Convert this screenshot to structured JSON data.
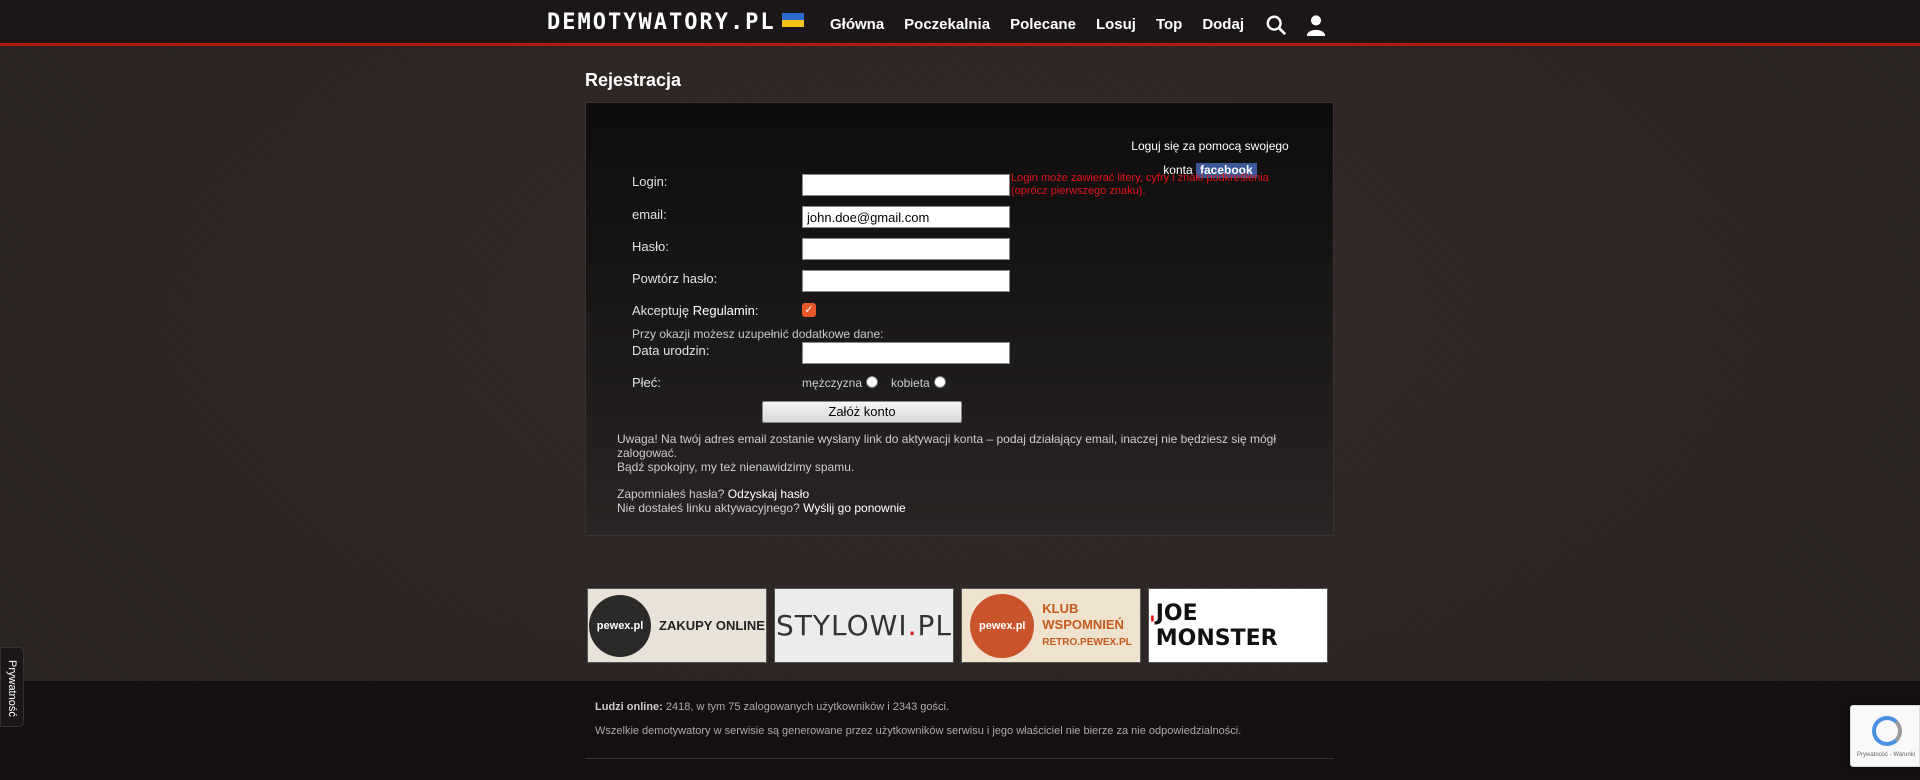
{
  "header": {
    "logo_text": "DEMOTYWATORY.PL",
    "nav": [
      "Główna",
      "Poczekalnia",
      "Polecane",
      "Losuj",
      "Top",
      "Dodaj"
    ],
    "search_icon": "search-icon",
    "user_icon": "user-icon"
  },
  "page": {
    "title": "Rejestracja"
  },
  "facebook": {
    "text_line1": "Loguj się za pomocą swojego",
    "text_line2": "konta",
    "badge": "facebook"
  },
  "form": {
    "login_label": "Login:",
    "login_value": "",
    "login_hint": "Login może zawierać litery, cyfry i znaki podkreślenia (oprócz pierwszego znaku).",
    "email_label": "email:",
    "email_value": "john.doe@gmail.com",
    "password_label": "Hasło:",
    "password_value": "",
    "password_repeat_label": "Powtórz hasło:",
    "password_repeat_value": "",
    "accept_prefix": "Akceptuję",
    "accept_link": "Regulamin",
    "accept_suffix": ":",
    "accept_checked": true,
    "extra_info": "Przy okazji możesz uzupełnić dodatkowe dane:",
    "birthdate_label": "Data urodzin:",
    "birthdate_value": "",
    "gender_label": "Płeć:",
    "gender_male": "mężczyzna",
    "gender_female": "kobieta",
    "submit_label": "Załóż konto"
  },
  "notices": {
    "warning": "Uwaga! Na twój adres email zostanie wysłany link do aktywacji konta – podaj działający email, inaczej nie będziesz się mógł zalogować.",
    "nospam": "Bądź spokojny, my też nienawidzimy spamu.",
    "forgot_prefix": "Zapomniałeś hasła?",
    "forgot_link": "Odzyskaj hasło",
    "resend_prefix": "Nie dostałeś linku aktywacyjnego?",
    "resend_link": "Wyślij go ponownie"
  },
  "banners": {
    "pewex_logo": "pewex.pl",
    "pewex_text": "ZAKUPY ONLINE",
    "stylowi_text": "STYLOWI",
    "stylowi_dot": ".",
    "stylowi_suffix": "PL",
    "klub_logo": "pewex.pl",
    "klub_line1": "KLUB",
    "klub_line2": "WSPOMNIEŃ",
    "klub_line3": "RETRO.PEWEX.PL",
    "joe_mark": "'",
    "joe_text": "JOE MONSTER"
  },
  "footer": {
    "online_label": "Ludzi online:",
    "online_text": "2418, w tym 75 zalogowanych użytkowników i 2343 gości.",
    "disclaimer": "Wszelkie demotywatory w serwisie są generowane przez użytkowników serwisu i jego właściciel nie bierze za nie odpowiedzialności."
  },
  "privacy": {
    "label": "Prywatność"
  },
  "recaptcha": {
    "text": "Prywatność - Warunki"
  },
  "colors": {
    "accent_red": "#b21d12",
    "hint_red": "#e0141a",
    "facebook_blue": "#3b5998",
    "checkbox_orange": "#e8572a"
  }
}
